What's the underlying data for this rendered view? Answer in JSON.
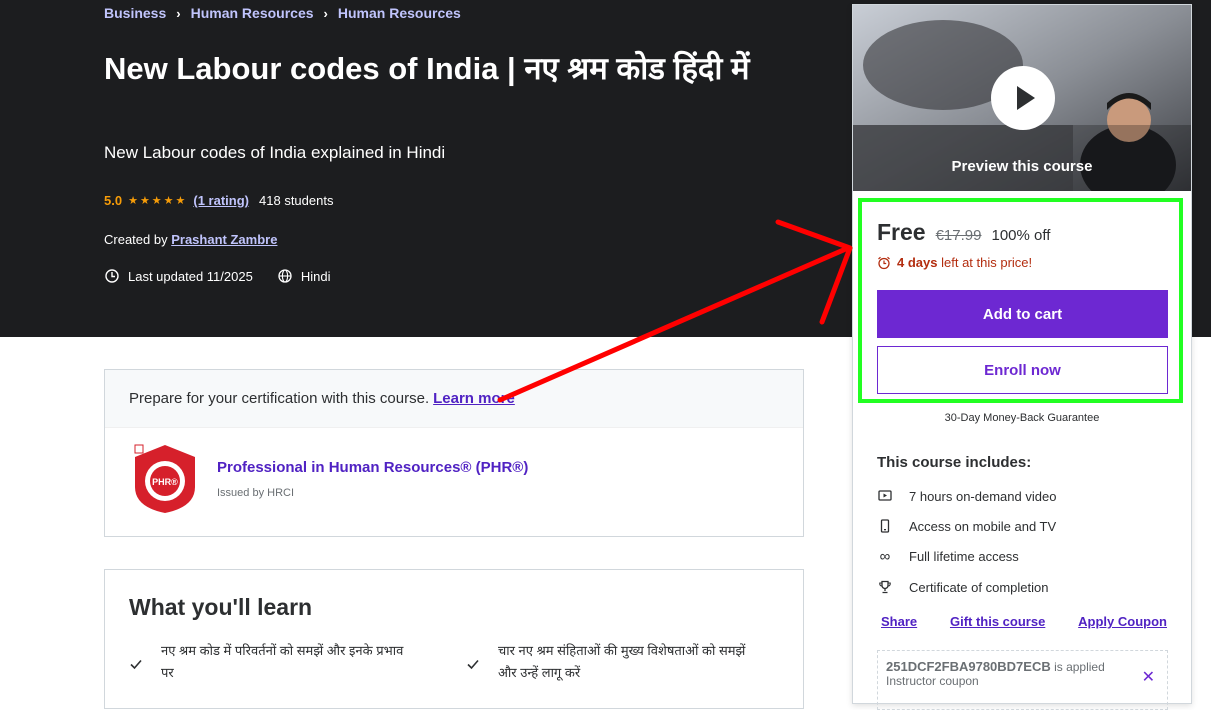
{
  "breadcrumb": [
    "Business",
    "Human Resources",
    "Human Resources"
  ],
  "course": {
    "title": "New Labour codes of India | नए श्रम कोड हिंदी में",
    "subtitle": "New Labour codes of India explained in Hindi",
    "rating": "5.0",
    "stars": "★★★★★",
    "rating_count": "(1 rating)",
    "students": "418 students",
    "created_by_label": "Created by",
    "instructor": "Prashant Zambre",
    "last_updated": "Last updated 11/2025",
    "language": "Hindi"
  },
  "certification": {
    "prompt": "Prepare for your certification with this course.",
    "learn_more": "Learn more",
    "name": "Professional in Human Resources® (PHR®)",
    "issuer": "Issued by HRCI",
    "badge_text": "PHR®"
  },
  "learn": {
    "title": "What you'll learn",
    "items": [
      "नए श्रम कोड में परिवर्तनों को समझें और इनके प्रभाव पर",
      "चार नए श्रम संहिताओं की मुख्य विशेषताओं को समझें और उन्हें लागू करें"
    ]
  },
  "sidebar": {
    "preview_label": "Preview this course",
    "price": "Free",
    "original_price": "€17.99",
    "discount": "100% off",
    "timer_bold": "4 days",
    "timer_rest": "left at this price!",
    "add_to_cart": "Add to cart",
    "enroll_now": "Enroll now",
    "guarantee": "30-Day Money-Back Guarantee",
    "includes_title": "This course includes:",
    "includes": [
      {
        "icon": "video-icon",
        "text": "7 hours on-demand video"
      },
      {
        "icon": "mobile-icon",
        "text": "Access on mobile and TV"
      },
      {
        "icon": "infinity-icon",
        "text": "Full lifetime access"
      },
      {
        "icon": "trophy-icon",
        "text": "Certificate of completion"
      }
    ],
    "share": "Share",
    "gift": "Gift this course",
    "apply_coupon": "Apply Coupon",
    "coupon_code": "251DCF2FBA9780BD7ECB",
    "coupon_applied": "is applied",
    "coupon_type": "Instructor coupon"
  },
  "colors": {
    "hero_bg": "#1c1d1f",
    "primary": "#6d28d2",
    "link": "#5022c3",
    "star": "#f69c08",
    "annotation_green": "#22ff22",
    "annotation_red": "#ff0000"
  }
}
